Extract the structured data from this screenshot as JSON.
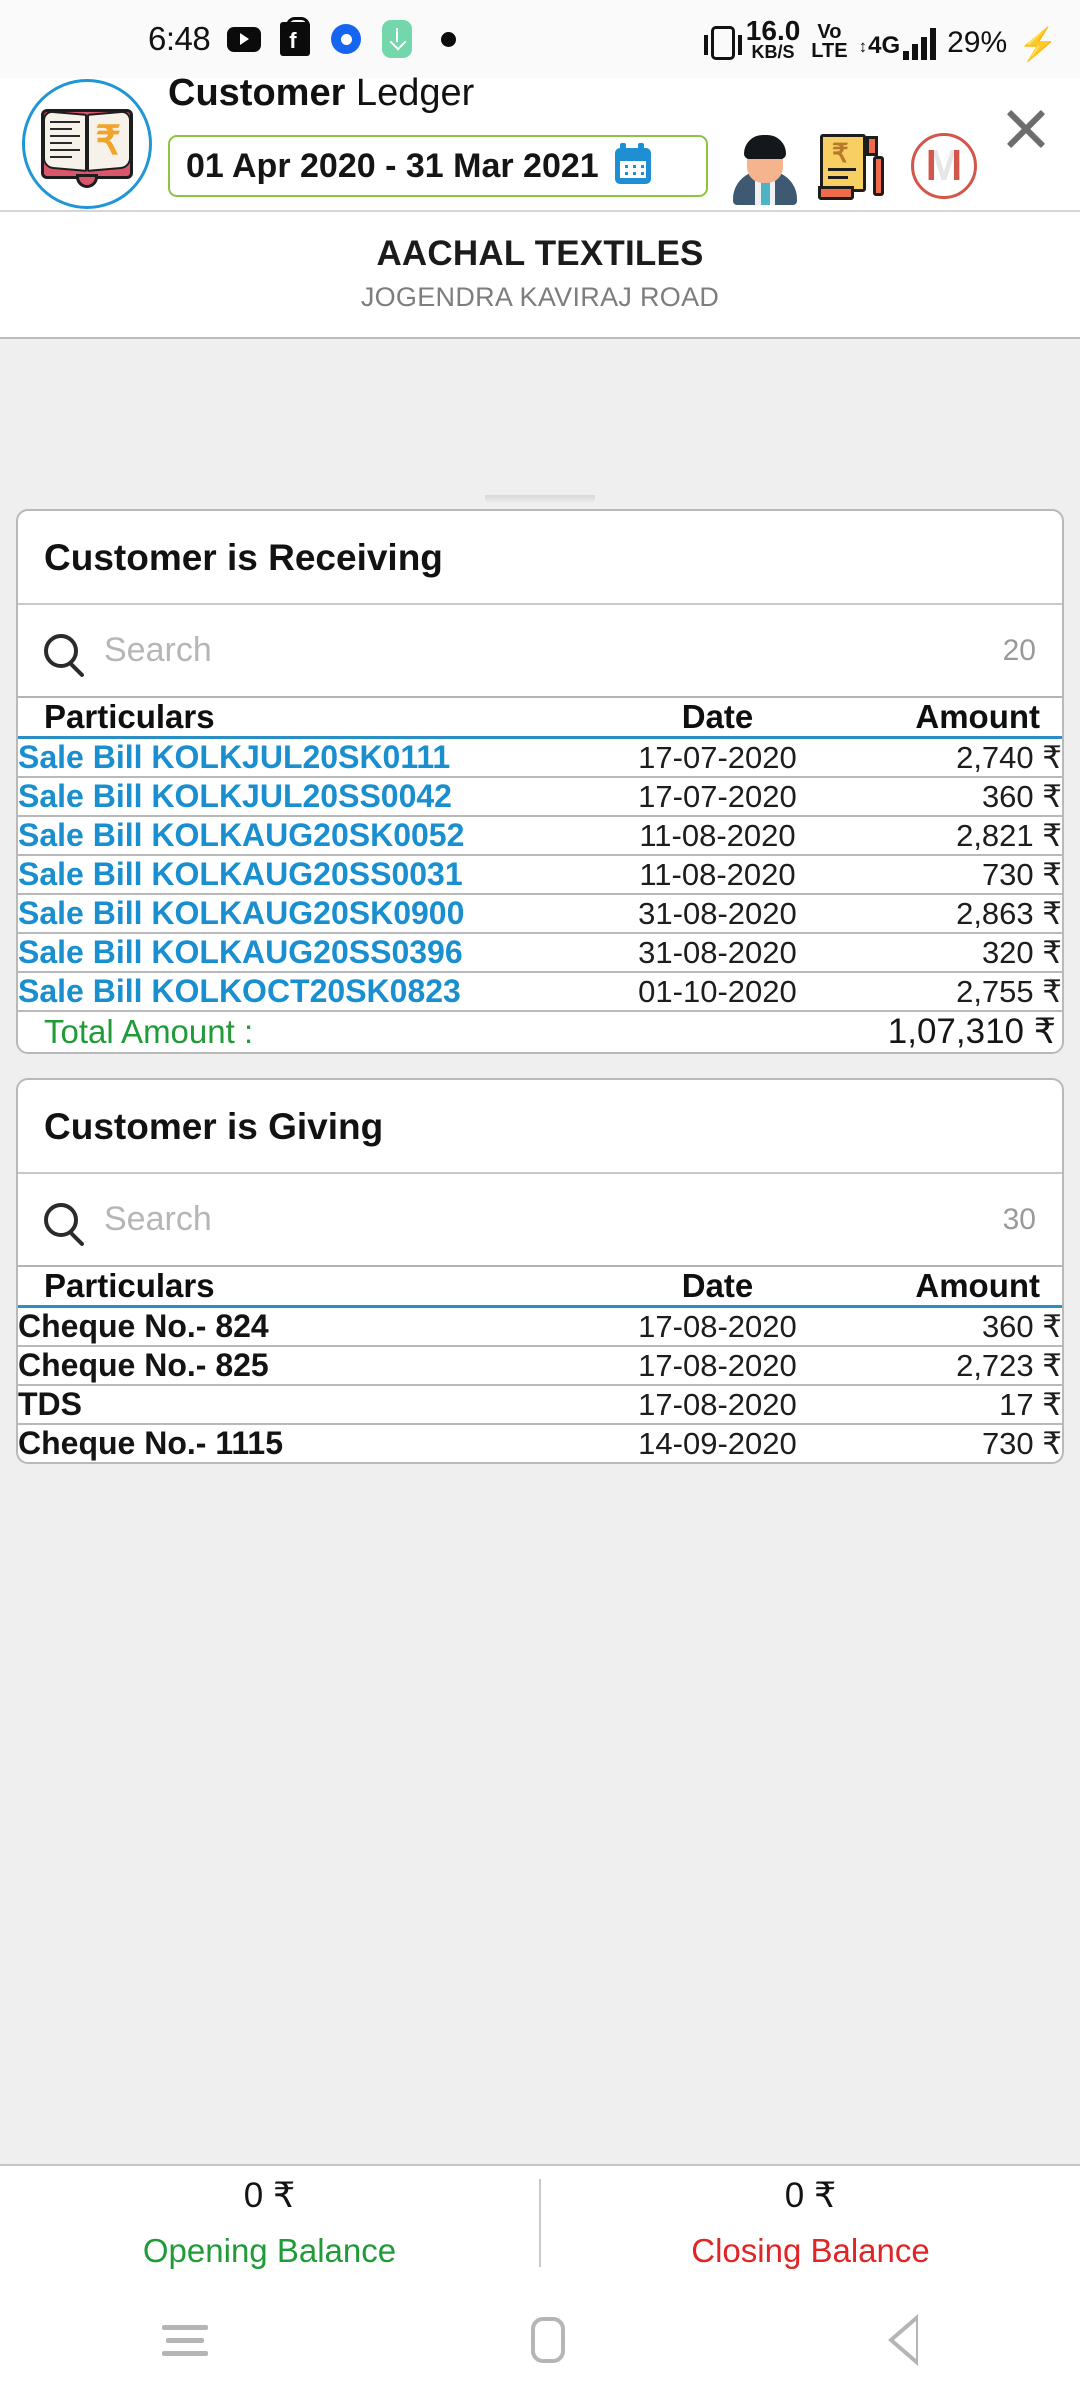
{
  "status_bar": {
    "time": "6:48",
    "left_icons": [
      "youtube-icon",
      "flipkart-icon",
      "blue-dot-icon",
      "download-icon",
      "dot-icon"
    ],
    "net_speed_value": "16.0",
    "net_speed_unit": "KB/S",
    "volte_top": "Vo",
    "volte_bottom": "LTE",
    "network_type": "4G",
    "battery": "29%"
  },
  "header": {
    "title_bold": "Customer",
    "title_light": " Ledger",
    "date_range": "01 Apr 2020 - 31 Mar 2021",
    "logo_name": "ledger-book-icon",
    "icons": [
      "customer-avatar-icon",
      "bill-icon",
      "gmail-icon",
      "close-icon"
    ]
  },
  "customer": {
    "name": "AACHAL TEXTILES",
    "address": "JOGENDRA KAVIRAJ ROAD"
  },
  "receiving": {
    "title": "Customer is Receiving",
    "search_placeholder": "Search",
    "count": "20",
    "columns": [
      "Particulars",
      "Date",
      "Amount"
    ],
    "rows": [
      {
        "particulars": "Sale Bill KOLKJUL20SK0111",
        "date": "17-07-2020",
        "amount": "2,740 ₹"
      },
      {
        "particulars": "Sale Bill KOLKJUL20SS0042",
        "date": "17-07-2020",
        "amount": "360 ₹"
      },
      {
        "particulars": "Sale Bill KOLKAUG20SK0052",
        "date": "11-08-2020",
        "amount": "2,821 ₹"
      },
      {
        "particulars": "Sale Bill KOLKAUG20SS0031",
        "date": "11-08-2020",
        "amount": "730 ₹"
      },
      {
        "particulars": "Sale Bill KOLKAUG20SK0900",
        "date": "31-08-2020",
        "amount": "2,863 ₹"
      },
      {
        "particulars": "Sale Bill KOLKAUG20SS0396",
        "date": "31-08-2020",
        "amount": "320 ₹"
      },
      {
        "particulars": "Sale Bill KOLKOCT20SK0823",
        "date": "01-10-2020",
        "amount": "2,755 ₹"
      }
    ],
    "total_label": "Total Amount :",
    "total_value": "1,07,310 ₹"
  },
  "giving": {
    "title": "Customer is Giving",
    "search_placeholder": "Search",
    "count": "30",
    "columns": [
      "Particulars",
      "Date",
      "Amount"
    ],
    "rows": [
      {
        "particulars": "Cheque No.- 824",
        "date": "17-08-2020",
        "amount": "360 ₹"
      },
      {
        "particulars": "Cheque No.- 825",
        "date": "17-08-2020",
        "amount": "2,723 ₹"
      },
      {
        "particulars": "TDS",
        "date": "17-08-2020",
        "amount": "17 ₹"
      },
      {
        "particulars": "Cheque No.- 1115",
        "date": "14-09-2020",
        "amount": "730 ₹"
      }
    ]
  },
  "balances": {
    "opening_amount": "0 ₹",
    "opening_label": "Opening Balance",
    "closing_amount": "0 ₹",
    "closing_label": "Closing Balance"
  },
  "nav": {
    "recent": "recent-apps-button",
    "home": "home-button",
    "back": "back-button"
  },
  "colors": {
    "link_blue": "#1a8fd0",
    "accent_blue": "#2a8dc4",
    "green": "#1f9b37",
    "red": "#e02525",
    "date_border_green": "#8cc63e"
  }
}
